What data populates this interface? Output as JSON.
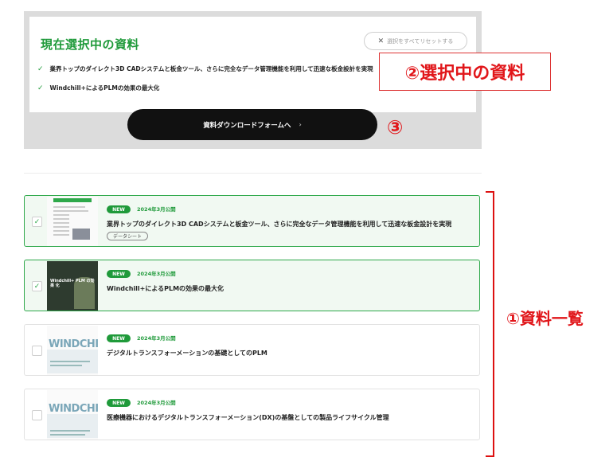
{
  "selection": {
    "title": "現在選択中の資料",
    "reset_label": "選択をすべてリセットする",
    "items": [
      "業界トップのダイレクト3D CADシステムと板金ツール、さらに完全なデータ管理機能を利用して迅速な板金設計を実現",
      "Windchill+によるPLMの効果の最大化"
    ],
    "form_button": "資料ダウンロードフォームへ",
    "form_arrow": "›"
  },
  "annotations": {
    "selected_docs": "②選択中の資料",
    "step3": "③",
    "doc_list": "①資料一覧"
  },
  "documents": [
    {
      "badge": "NEW",
      "date": "2024年3月公開",
      "title": "業界トップのダイレクト3D CADシステムと板金ツール、さらに完全なデータ管理機能を利用して迅速な板金設計を実現",
      "tag": "データシート",
      "checked": true,
      "check_mark": "✓"
    },
    {
      "badge": "NEW",
      "date": "2024年3月公開",
      "title": "Windchill+によるPLMの効果の最大化",
      "checked": true,
      "check_mark": "✓"
    },
    {
      "badge": "NEW",
      "date": "2024年3月公開",
      "title": "デジタルトランスフォーメーションの基礎としてのPLM",
      "checked": false
    },
    {
      "badge": "NEW",
      "date": "2024年3月公開",
      "title": "医療機器におけるデジタルトランスフォーメーション(DX)の基盤としての製品ライフサイクル管理",
      "checked": false
    }
  ],
  "thumb_text": {
    "windchill_logo": "WINDCHILL",
    "doc2_cover": "Windchill+ PLM の効果 化"
  },
  "colors": {
    "accent": "#1f9a3a",
    "annotation": "#e1161a",
    "button_bg": "#111111"
  }
}
